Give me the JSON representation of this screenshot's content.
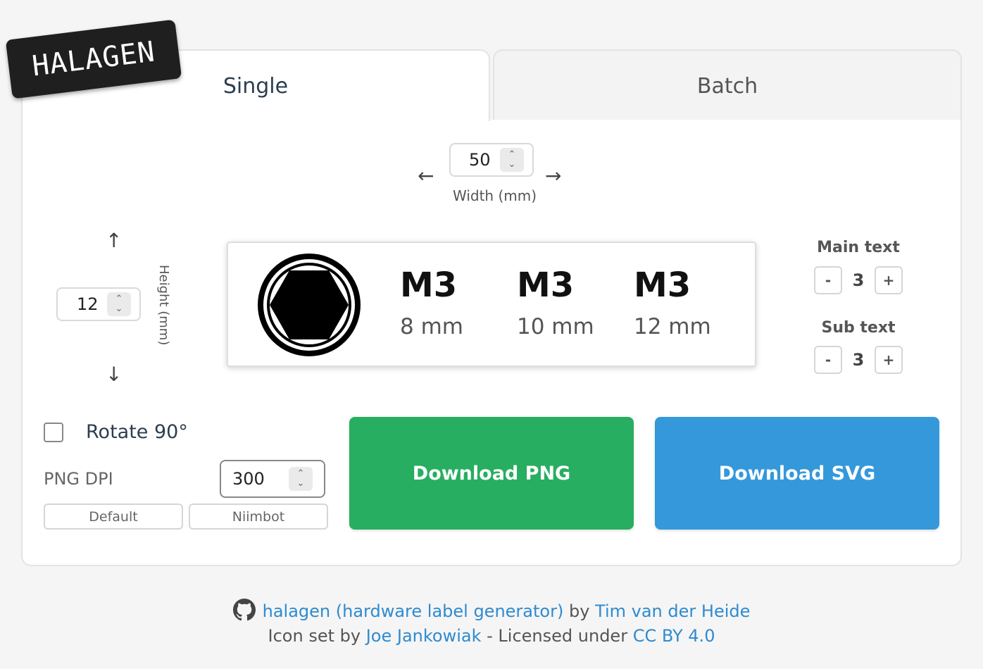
{
  "logo": {
    "text": "HALAGEN"
  },
  "tabs": [
    {
      "label": "Single",
      "active": true
    },
    {
      "label": "Batch",
      "active": false
    }
  ],
  "width_control": {
    "value": "50",
    "caption": "Width (mm)",
    "left_arrow": "←",
    "right_arrow": "→"
  },
  "height_control": {
    "value": "12",
    "caption": "Height (mm)",
    "up_arrow": "↑",
    "down_arrow": "↓"
  },
  "preview": {
    "icon": "hex-socket-icon",
    "columns": [
      {
        "main": "M3",
        "sub": "8 mm"
      },
      {
        "main": "M3",
        "sub": "10 mm"
      },
      {
        "main": "M3",
        "sub": "12 mm"
      }
    ]
  },
  "text_size": {
    "main": {
      "title": "Main text",
      "value": "3",
      "minus": "-",
      "plus": "+"
    },
    "sub": {
      "title": "Sub text",
      "value": "3",
      "minus": "-",
      "plus": "+"
    }
  },
  "options": {
    "rotate_label": "Rotate 90°",
    "rotate_checked": false,
    "dpi_label": "PNG DPI",
    "dpi_value": "300",
    "presets": [
      "Default",
      "Niimbot"
    ]
  },
  "downloads": {
    "png": "Download PNG",
    "svg": "Download SVG"
  },
  "footer": {
    "line1": {
      "link1": "halagen (hardware label generator)",
      "by": "by",
      "author": "Tim van der Heide"
    },
    "line2": {
      "prefix": "Icon set by",
      "icon_author": "Joe Jankowiak",
      "middle": "- Licensed under",
      "license": "CC BY 4.0"
    }
  },
  "colors": {
    "png_button": "#27ae60",
    "svg_button": "#3498db",
    "link": "#2e8bd0"
  }
}
